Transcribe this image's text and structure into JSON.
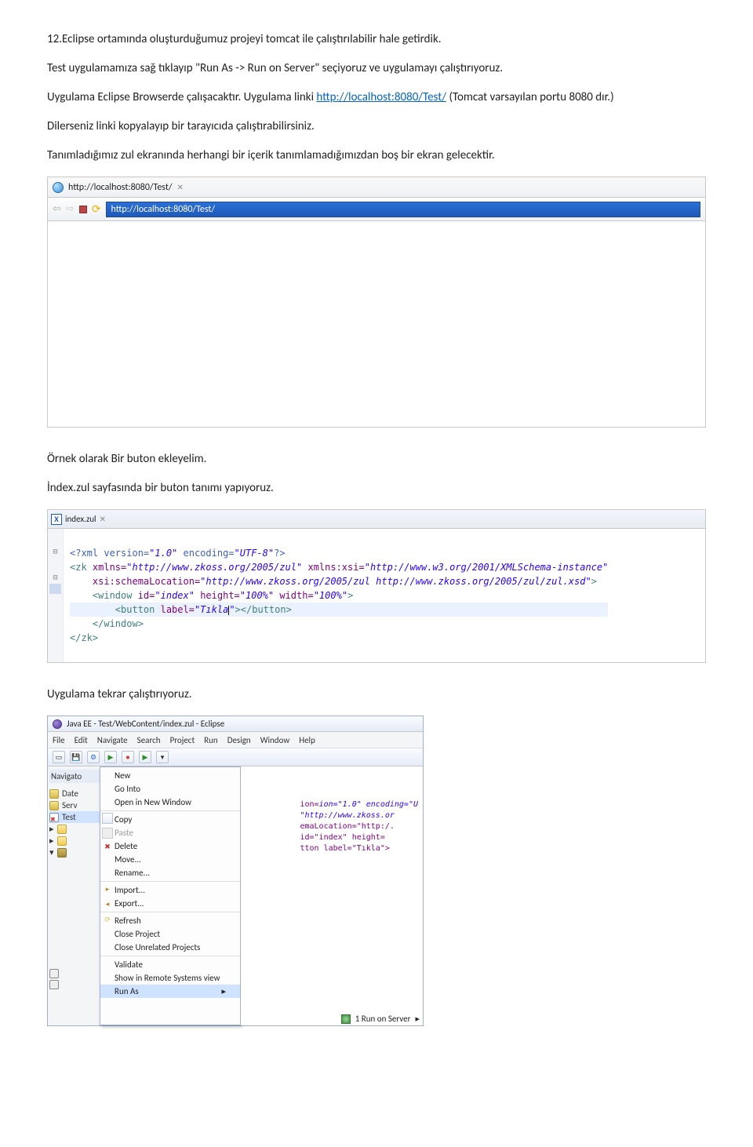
{
  "paragraphs": {
    "p1_prefix": "12.",
    "p1": "Eclipse ortamında oluşturduğumuz projeyi tomcat ile çalıştırılabilir hale getirdik.",
    "p2": "Test uygulamamıza sağ tıklayıp \"Run As -> Run on Server\"  seçiyoruz ve uygulamayı çalıştırıyoruz.",
    "p3a": "Uygulama Eclipse Browserde çalışacaktır. Uygulama linki  ",
    "p3_link": "http://localhost:8080/Test/",
    "p3b": "  (Tomcat varsayılan portu 8080 dır.)",
    "p4": "Dilerseniz linki kopyalayıp bir tarayıcıda çalıştırabilirsiniz.",
    "p5": "Tanımladığımız zul ekranında herhangi bir içerik tanımlamadığımızdan  boş bir ekran gelecektir.",
    "p6": "Örnek olarak Bir buton ekleyelim.",
    "p7": "İndex.zul sayfasında bir buton tanımı yapıyoruz.",
    "p8": "Uygulama tekrar çalıştırıyoruz."
  },
  "browser": {
    "tab_label": "http://localhost:8080/Test/",
    "tab_close": "✕",
    "address": "http://localhost:8080/Test/"
  },
  "editor": {
    "tab_label": "index.zul",
    "tab_close": "✕",
    "lines": {
      "l1_pi": "<?xml version=",
      "l1_v1": "\"1.0\"",
      "l1_enc": " encoding=",
      "l1_v2": "\"UTF-8\"",
      "l1_end": "?>",
      "l2_zk": "<zk ",
      "l2_a1": "xmlns=",
      "l2_v1": "\"http://www.zkoss.org/2005/zul\"",
      "l2_a2": " xmlns:xsi=",
      "l2_v2": "\"http://www.w3.org/2001/XMLSchema-instance\"",
      "l3_a1": "    xsi:schemaLocation=",
      "l3_v1": "\"http://www.zkoss.org/2005/zul http://www.zkoss.org/2005/zul/zul.xsd\"",
      "l3_end": ">",
      "l4_win": "    <window ",
      "l4_a1": "id=",
      "l4_v1": "\"index\"",
      "l4_a2": " height=",
      "l4_v2": "\"100%\"",
      "l4_a3": " width=",
      "l4_v3": "\"100%\"",
      "l4_end": ">",
      "l5_btn": "        <button ",
      "l5_a1": "label=",
      "l5_v1a": "\"Tıkla",
      "l5_v1b": "\"",
      "l5_end": "></button>",
      "l6": "    </window>",
      "l7": "</zk>"
    }
  },
  "ide": {
    "title": "Java EE - Test/WebContent/index.zul - Eclipse",
    "menu": [
      "File",
      "Edit",
      "Navigate",
      "Search",
      "Project",
      "Run",
      "Design",
      "Window",
      "Help"
    ],
    "navigator": "Navigato",
    "tree": [
      "Date",
      "Serv",
      "Test"
    ],
    "context_menu": [
      {
        "label": "New",
        "icon": "",
        "disabled": false
      },
      {
        "label": "Go Into",
        "icon": "",
        "disabled": false
      },
      {
        "label": "Open in New Window",
        "icon": "",
        "disabled": false,
        "sep": false
      },
      {
        "label": "Copy",
        "icon": "copy",
        "disabled": false,
        "sep": true
      },
      {
        "label": "Paste",
        "icon": "paste",
        "disabled": true
      },
      {
        "label": "Delete",
        "icon": "del",
        "disabled": false
      },
      {
        "label": "Move...",
        "icon": "",
        "disabled": false
      },
      {
        "label": "Rename...",
        "icon": "",
        "disabled": false
      },
      {
        "label": "Import...",
        "icon": "imp",
        "disabled": false,
        "sep": true
      },
      {
        "label": "Export...",
        "icon": "exp",
        "disabled": false
      },
      {
        "label": "Refresh",
        "icon": "ref",
        "disabled": false,
        "sep": true
      },
      {
        "label": "Close Project",
        "icon": "",
        "disabled": false
      },
      {
        "label": "Close Unrelated Projects",
        "icon": "",
        "disabled": false
      },
      {
        "label": "Validate",
        "icon": "",
        "disabled": false,
        "sep": true
      },
      {
        "label": "Show in Remote Systems view",
        "icon": "",
        "disabled": false
      },
      {
        "label": "Run As",
        "icon": "",
        "disabled": false,
        "hl": true
      }
    ],
    "snippet": {
      "l1": "ion=\"1.0\" encoding=\"U",
      "l2": "\"http://www.zkoss.or",
      "l3": "emaLocation=\"http:/.",
      "l4": "id=\"index\" height=",
      "l5": "tton label=\"Tıkla\">"
    },
    "submenu_label": "1 Run on Server",
    "submenu_suffix": "▸"
  }
}
